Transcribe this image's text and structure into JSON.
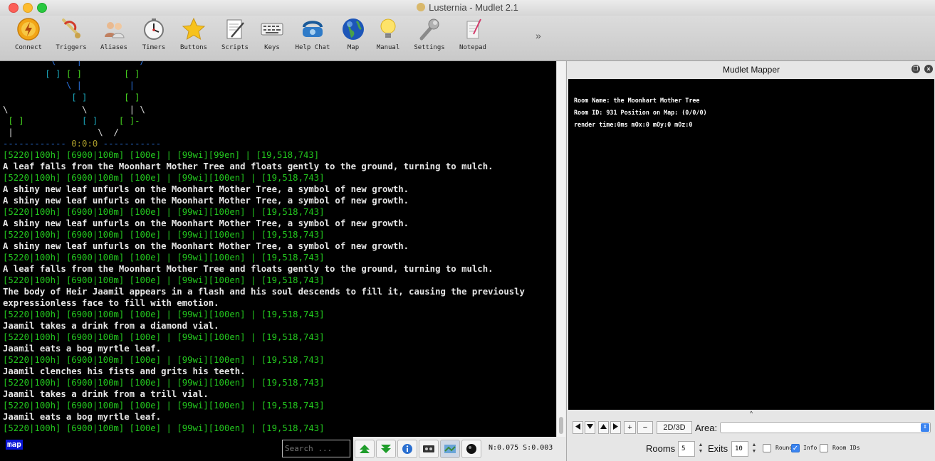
{
  "window": {
    "title": "Lusternia - Mudlet 2.1"
  },
  "toolbar": {
    "items": [
      {
        "label": "Connect",
        "icon": "connect-icon"
      },
      {
        "label": "Triggers",
        "icon": "triggers-icon"
      },
      {
        "label": "Aliases",
        "icon": "aliases-icon"
      },
      {
        "label": "Timers",
        "icon": "timers-icon"
      },
      {
        "label": "Buttons",
        "icon": "buttons-icon"
      },
      {
        "label": "Scripts",
        "icon": "scripts-icon"
      },
      {
        "label": "Keys",
        "icon": "keys-icon"
      },
      {
        "label": "Help Chat",
        "icon": "help-chat-icon"
      },
      {
        "label": "Map",
        "icon": "map-icon"
      },
      {
        "label": "Manual",
        "icon": "manual-icon"
      },
      {
        "label": "Settings",
        "icon": "settings-icon"
      },
      {
        "label": "Notepad",
        "icon": "notepad-icon"
      }
    ],
    "overflow": "»"
  },
  "console": {
    "ascii_map": [
      {
        "t": "         \\    |           /",
        "c": "bw"
      },
      {
        "t": "        [ ] [ ]        [ ]",
        "c": "mix1"
      },
      {
        "t": "            \\ |         |",
        "c": "bw"
      },
      {
        "t": "             [ ]       [ ]",
        "c": "mix2"
      },
      {
        "t": "\\              \\        | \\",
        "c": "wh"
      },
      {
        "t": " [ ]           [ ]    [ ]-",
        "c": "mix3"
      },
      {
        "t": " |                \\  /",
        "c": "wh"
      },
      {
        "t": "------------ 0:0:0 -----------",
        "c": "coords"
      }
    ],
    "coords": "0:0:0",
    "lines": [
      {
        "t": "[5220|100h] [6900|100m] [100e] | [99wi][99en] | [19,518,743]",
        "c": "g"
      },
      {
        "t": "A leaf falls from the Moonhart Mother Tree and floats gently to the ground, turning to mulch.",
        "c": "w"
      },
      {
        "t": "[5220|100h] [6900|100m] [100e] | [99wi][100en] | [19,518,743]",
        "c": "g"
      },
      {
        "t": "A shiny new leaf unfurls on the Moonhart Mother Tree, a symbol of new growth.",
        "c": "w"
      },
      {
        "t": "A shiny new leaf unfurls on the Moonhart Mother Tree, a symbol of new growth.",
        "c": "w"
      },
      {
        "t": "[5220|100h] [6900|100m] [100e] | [99wi][100en] | [19,518,743]",
        "c": "g"
      },
      {
        "t": "A shiny new leaf unfurls on the Moonhart Mother Tree, a symbol of new growth.",
        "c": "w"
      },
      {
        "t": "[5220|100h] [6900|100m] [100e] | [99wi][100en] | [19,518,743]",
        "c": "g"
      },
      {
        "t": "A shiny new leaf unfurls on the Moonhart Mother Tree, a symbol of new growth.",
        "c": "w"
      },
      {
        "t": "[5220|100h] [6900|100m] [100e] | [99wi][100en] | [19,518,743]",
        "c": "g"
      },
      {
        "t": "A leaf falls from the Moonhart Mother Tree and floats gently to the ground, turning to mulch.",
        "c": "w"
      },
      {
        "t": "[5220|100h] [6900|100m] [100e] | [99wi][100en] | [19,518,743]",
        "c": "g"
      },
      {
        "t": "The body of Heir Jaamil appears in a flash and his soul descends to fill it, causing the previously",
        "c": "w"
      },
      {
        "t": "expressionless face to fill with emotion.",
        "c": "w"
      },
      {
        "t": "[5220|100h] [6900|100m] [100e] | [99wi][100en] | [19,518,743]",
        "c": "g"
      },
      {
        "t": "Jaamil takes a drink from a diamond vial.",
        "c": "w"
      },
      {
        "t": "[5220|100h] [6900|100m] [100e] | [99wi][100en] | [19,518,743]",
        "c": "g"
      },
      {
        "t": "Jaamil eats a bog myrtle leaf.",
        "c": "w"
      },
      {
        "t": "[5220|100h] [6900|100m] [100e] | [99wi][100en] | [19,518,743]",
        "c": "g"
      },
      {
        "t": "Jaamil clenches his fists and grits his teeth.",
        "c": "w"
      },
      {
        "t": "[5220|100h] [6900|100m] [100e] | [99wi][100en] | [19,518,743]",
        "c": "g"
      },
      {
        "t": "Jaamil takes a drink from a trill vial.",
        "c": "w"
      },
      {
        "t": "[5220|100h] [6900|100m] [100e] | [99wi][100en] | [19,518,743]",
        "c": "g"
      },
      {
        "t": "Jaamil eats a bog myrtle leaf.",
        "c": "w"
      },
      {
        "t": "[5220|100h] [6900|100m] [100e] | [99wi][100en] | [19,518,743]",
        "c": "g"
      }
    ]
  },
  "bottombar": {
    "map_link": "map",
    "search_placeholder": "Search ...",
    "net_info": "N:0.075 S:0.003"
  },
  "mapper": {
    "title": "Mudlet Mapper",
    "room_name": "Room Name: the Moonhart Mother Tree",
    "room_id": "Room ID: 931 Position on Map: (0/0/0)",
    "render": "render time:0ms mOx:0 mOy:0 mOz:0",
    "caret": "^",
    "nav": {
      "plus": "+",
      "minus": "−",
      "mode": "2D/3D",
      "area_label": "Area:"
    },
    "options": {
      "rooms_label": "Rooms",
      "rooms_value": "5",
      "exits_label": "Exits",
      "exits_value": "10",
      "round_label": "Round",
      "round_checked": false,
      "info_label": "Info",
      "info_checked": true,
      "room_ids_label": "Room IDs",
      "room_ids_checked": false
    }
  }
}
